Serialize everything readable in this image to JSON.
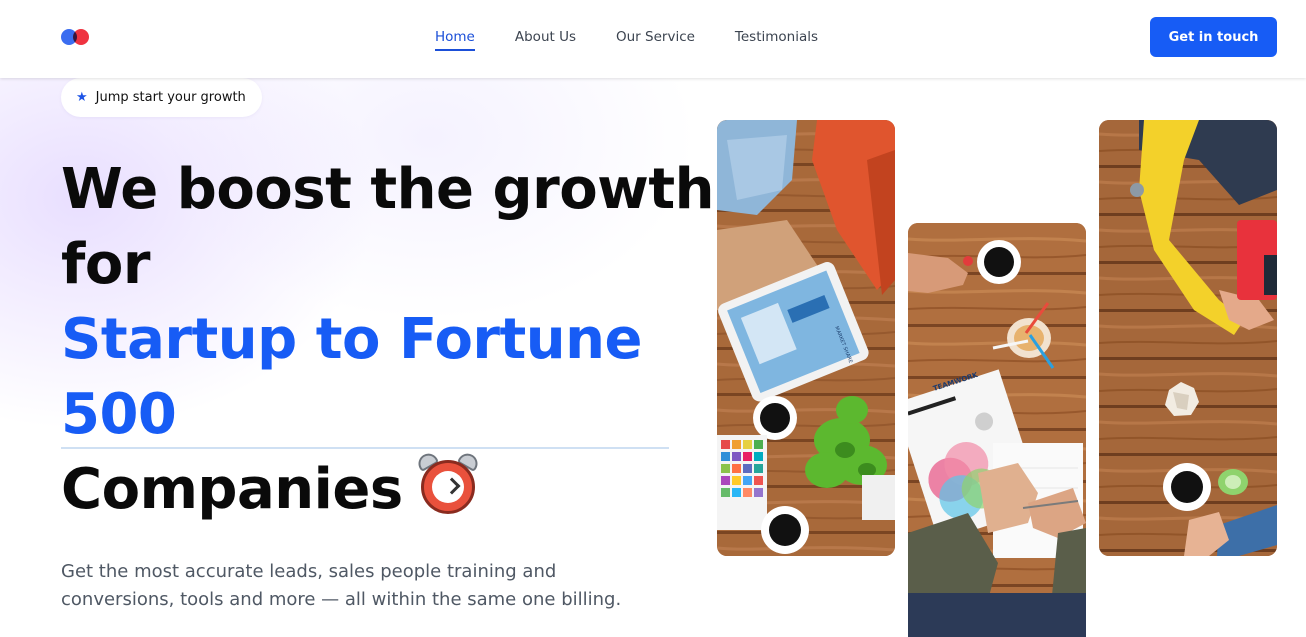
{
  "brand": {
    "logo_colors": [
      "#3b6df0",
      "#ef3340"
    ]
  },
  "nav": {
    "items": [
      {
        "label": "Home",
        "active": true
      },
      {
        "label": "About Us",
        "active": false
      },
      {
        "label": "Our Service",
        "active": false
      },
      {
        "label": "Testimonials",
        "active": false
      }
    ]
  },
  "header": {
    "cta_label": "Get in touch"
  },
  "hero": {
    "badge_icon": "star-icon",
    "badge_text": "Jump start your growth",
    "headline_line1": "We boost the growth",
    "headline_line2": "for",
    "headline_highlight_line1": "Startup to Fortune",
    "headline_highlight_line2": "500",
    "headline_line3": "Companies",
    "headline_emoji": "alarm-clock-icon",
    "description_line1": "Get the most accurate leads, sales people training and",
    "description_line2": "conversions, tools and more — all within the same one billing.",
    "gallery_image_labels": [
      "MARKET SHARE",
      "TEAMWORK"
    ]
  },
  "colors": {
    "accent": "#175cf5",
    "text_dark": "#0a0a0a",
    "text_muted": "#4f5864",
    "nav_text": "#3c4450"
  }
}
